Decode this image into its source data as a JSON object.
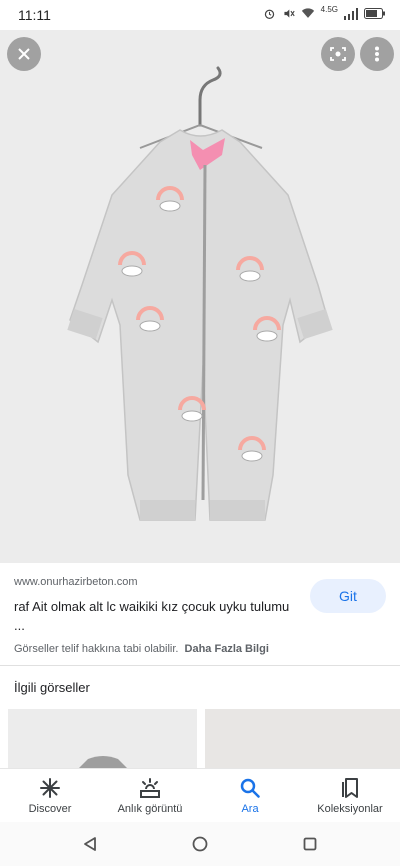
{
  "status_bar": {
    "time": "11:11",
    "network_label": "4.5G",
    "icons": [
      "alarm-icon",
      "mute-icon",
      "wifi-icon",
      "signal-icon",
      "battery-icon"
    ]
  },
  "image_viewer": {
    "close_icon": "close-icon",
    "lens_icon": "lens-icon",
    "more_icon": "more-vert-icon"
  },
  "result": {
    "source": "www.onurhazirbeton.com",
    "title": "raf Ait olmak alt lc waikiki kız çocuk uyku tulumu ...",
    "visit_label": "Git",
    "copyright_text": "Görseller telif hakkına tabi olabilir.",
    "learn_more": "Daha Fazla Bilgi"
  },
  "related": {
    "heading": "İlgili görseller"
  },
  "bottom_nav": [
    {
      "label": "Discover",
      "icon": "discover-icon",
      "active": false
    },
    {
      "label": "Anlık görüntü",
      "icon": "snapshot-icon",
      "active": false
    },
    {
      "label": "Ara",
      "icon": "search-icon",
      "active": true
    },
    {
      "label": "Koleksiyonlar",
      "icon": "collections-icon",
      "active": false
    }
  ],
  "colors": {
    "accent": "#1a73e8",
    "accent_bg": "#e8f0fe",
    "image_bg": "#ececec",
    "garment": "#d9d9d9",
    "garment_lining": "#f48fb1"
  }
}
